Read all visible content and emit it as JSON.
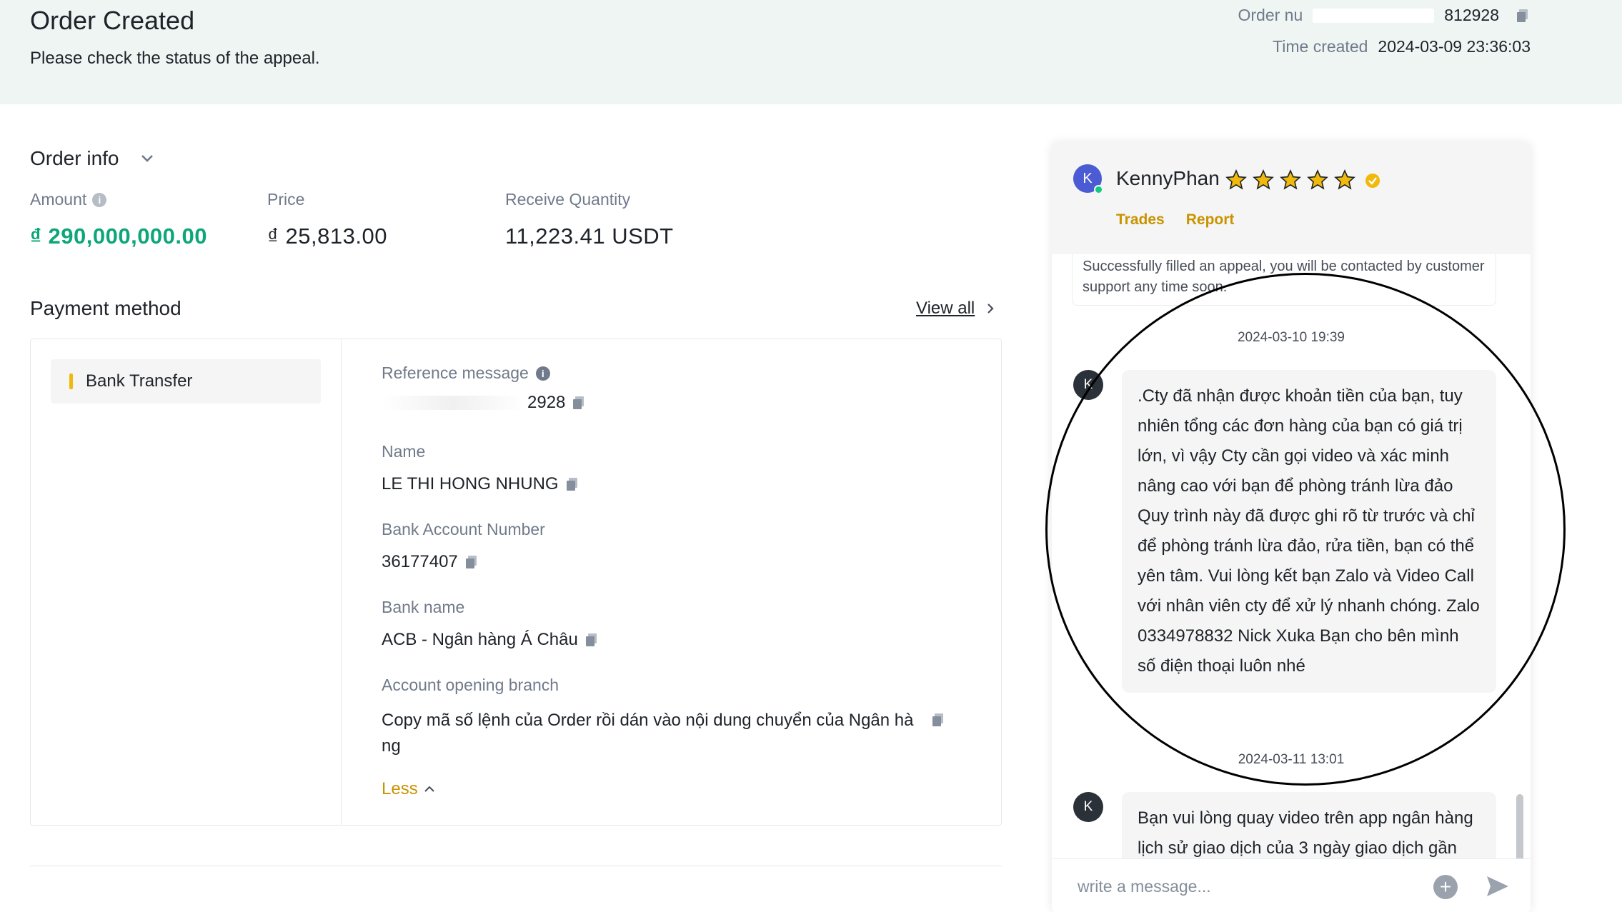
{
  "header": {
    "title": "Order Created",
    "subtitle": "Please check the status of the appeal.",
    "order_number_label": "Order nu",
    "order_number_value": "812928",
    "time_created_label": "Time created",
    "time_created_value": "2024-03-09 23:36:03"
  },
  "order_info": {
    "title": "Order info",
    "amount_label": "Amount",
    "amount_value": "₫ 290,000,000.00",
    "price_label": "Price",
    "price_value": "₫ 25,813.00",
    "qty_label": "Receive Quantity",
    "qty_value": "11,223.41 USDT"
  },
  "payment": {
    "title": "Payment method",
    "view_all": "View all",
    "method_tab": "Bank Transfer",
    "reference_label": "Reference message",
    "reference_value": "2928",
    "name_label": "Name",
    "name_value": "LE THI HONG NHUNG",
    "account_label": "Bank Account Number",
    "account_value": "36177407",
    "bank_label": "Bank name",
    "bank_value": "ACB - Ngân hàng Á Châu",
    "branch_label": "Account opening branch",
    "branch_value": "Copy mã số lệnh của Order rồi dán vào nội dung chuyển của Ngân hà ng",
    "less_link": "Less"
  },
  "chat": {
    "user_initial": "K",
    "user_name": "KennyPhan",
    "star_count": 5,
    "link_trades": "Trades",
    "link_report": "Report",
    "system_message": "Successfully filled an appeal, you will be contacted by customer support any time soon.",
    "messages": [
      {
        "timestamp": "2024-03-10 19:39",
        "initial": "K",
        "text": ".Cty đã nhận được khoản tiền của bạn, tuy nhiên tổng các đơn hàng của bạn có giá trị lớn, vì vậy Cty cần gọi video và xác minh nâng cao với bạn để phòng tránh lừa đảo Quy trình này đã được ghi rõ từ trước và chỉ để phòng tránh lừa đảo, rửa tiền, bạn có thể yên tâm. Vui lòng kết bạn Zalo và Video Call với nhân viên cty để xử lý nhanh chóng. Zalo 0334978832 Nick Xuka Bạn cho bên mình số điện thoại luôn nhé"
      },
      {
        "timestamp": "2024-03-11 13:01",
        "initial": "K",
        "text": "Bạn vui lòng quay video trên app ngân hàng lịch sử giao dịch của 3 ngày giao dịch gần"
      }
    ],
    "input_placeholder": "write a message..."
  },
  "colors": {
    "accent_green": "#0ca678",
    "accent_gold": "#c99400",
    "banner_bg": "#eef5f3",
    "star": "#f0b90b"
  }
}
